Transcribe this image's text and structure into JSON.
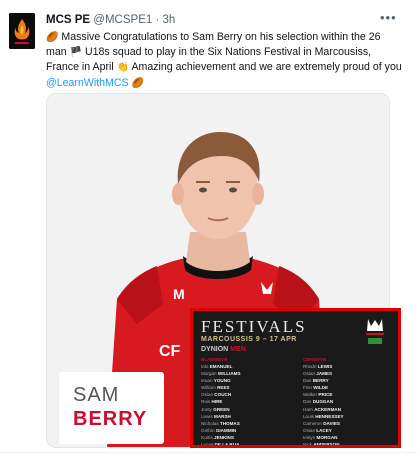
{
  "tweet": {
    "author_name": "MCS PE",
    "handle": "@MCSPE1",
    "separator": "·",
    "time": "3h",
    "more_icon": "more-icon",
    "line1_emoji": "🏉",
    "line1": " Massive Congratulations to Sam Berry on his selection within the 26",
    "line2_start": "man ",
    "flag_emoji": "🏴",
    "line2_end": " U18s squad to play in the Six Nations Festival in Marcousiss,",
    "line3": "France in April ",
    "clap_emoji": "👏",
    "line3_end": " Amazing achievement and we are extremely proud of you",
    "link": "@LearnWithMCS",
    "line4_emoji": "🏉"
  },
  "media": {
    "name_card": {
      "first": "SAM",
      "last": "BERRY"
    },
    "poster": {
      "title": "FESTIVALS",
      "subtitle": "MARCOUSSIS 9 – 17 APR",
      "team": "DYNION",
      "team_accent": "MEN",
      "left_header": "BLAENWYR",
      "right_header": "CEFNWYR",
      "left_rows": [
        {
          "first": "Iolo",
          "last": "EMANUEL"
        },
        {
          "first": "Morgan",
          "last": "WILLIAMS"
        },
        {
          "first": "Ieuan",
          "last": "YOUNG"
        },
        {
          "first": "William",
          "last": "REES"
        },
        {
          "first": "Osian",
          "last": "COUCH"
        },
        {
          "first": "Rois",
          "last": "HIRE"
        },
        {
          "first": "Jonty",
          "last": "GREEN"
        },
        {
          "first": "Lewis",
          "last": "MARSH"
        },
        {
          "first": "Nicholas",
          "last": "THOMAS"
        },
        {
          "first": "Gethin",
          "last": "GIAMMIN"
        },
        {
          "first": "Kurtis",
          "last": "JENKINS"
        },
        {
          "first": "Lucas",
          "last": "DE LA RUA"
        },
        {
          "first": "Sam",
          "last": "BERRY"
        },
        {
          "first": "Harry",
          "last": "BEDDALL"
        }
      ],
      "right_rows": [
        {
          "first": "Rhodri",
          "last": "LEWIS"
        },
        {
          "first": "Osian",
          "last": "JAMES"
        },
        {
          "first": "Dan",
          "last": "BERRY"
        },
        {
          "first": "Finn",
          "last": "WILDE"
        },
        {
          "first": "Walker",
          "last": "PRICE"
        },
        {
          "first": "Dan",
          "last": "DUGGAN"
        },
        {
          "first": "Harri",
          "last": "ACKERMAN"
        },
        {
          "first": "Louis",
          "last": "HENNESSEY"
        },
        {
          "first": "",
          "last": ""
        },
        {
          "first": "Cameron",
          "last": "DAVIES"
        },
        {
          "first": "Osian",
          "last": "LACEY"
        },
        {
          "first": "Iestyn",
          "last": "MORGAN"
        },
        {
          "first": "Nick",
          "last": "ANDERSON"
        },
        {
          "first": "",
          "last": ""
        }
      ]
    }
  }
}
